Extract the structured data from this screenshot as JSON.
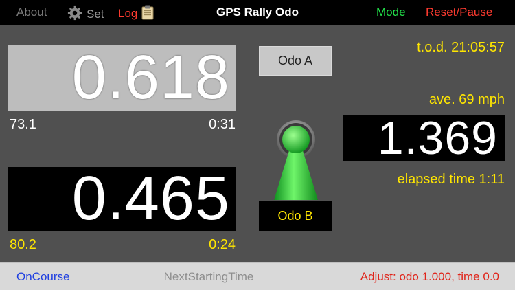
{
  "topbar": {
    "about_label": "About",
    "set_label": "Set",
    "log_label": "Log",
    "title": "GPS Rally Odo",
    "mode_label": "Mode",
    "reset_label": "Reset/Pause"
  },
  "odo_a": {
    "value": "0.618",
    "left_value": "73.1",
    "right_value": "0:31",
    "button_label": "Odo A"
  },
  "odo_b": {
    "value": "0.465",
    "left_value": "80.2",
    "right_value": "0:24",
    "button_label": "Odo B"
  },
  "right_panel": {
    "tod": "t.o.d. 21:05:57",
    "average": "ave. 69 mph",
    "value": "1.369",
    "elapsed": "elapsed time 1:11"
  },
  "bottombar": {
    "oncourse_label": "OnCourse",
    "next_starting_label": "NextStartingTime",
    "adjust_label": "Adjust: odo 1.000, time 0.0"
  },
  "colors": {
    "accent_red": "#ff3b30",
    "accent_green": "#22e04a",
    "accent_yellow": "#ffe600",
    "link_blue": "#1f3fe0"
  },
  "icons": {
    "set": "gear-icon",
    "log": "clipboard-icon",
    "selector": "pawn-icon"
  }
}
